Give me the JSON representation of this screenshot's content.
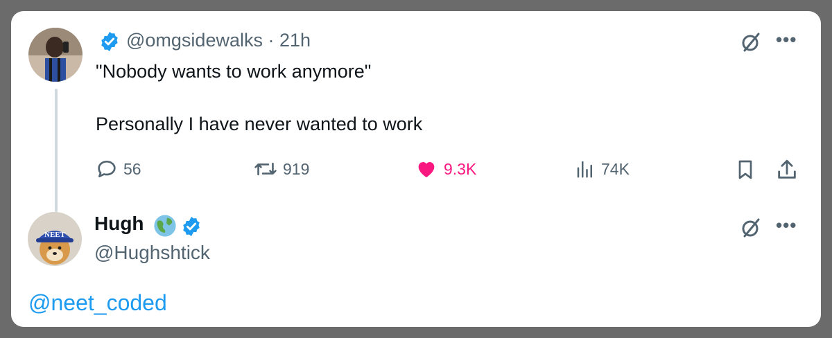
{
  "tweet": {
    "handle": "@omgsidewalks",
    "time": "· 21h",
    "line1": "\"Nobody wants to work anymore\"",
    "line2": "Personally I have never wanted to work",
    "actions": {
      "replies": "56",
      "reposts": "919",
      "likes": "9.3K",
      "views": "74K"
    },
    "more_icon": "more-horizontal-icon",
    "grok_icon": "slashed-circle-icon"
  },
  "reply": {
    "display_name": "Hugh",
    "handle": "@Hughshtick",
    "mention": "@neet_coded"
  },
  "colors": {
    "accent": "#1d9bf0",
    "like": "#f91880",
    "muted": "#536471",
    "text": "#0f1419",
    "frame": "#6b6b6b"
  }
}
